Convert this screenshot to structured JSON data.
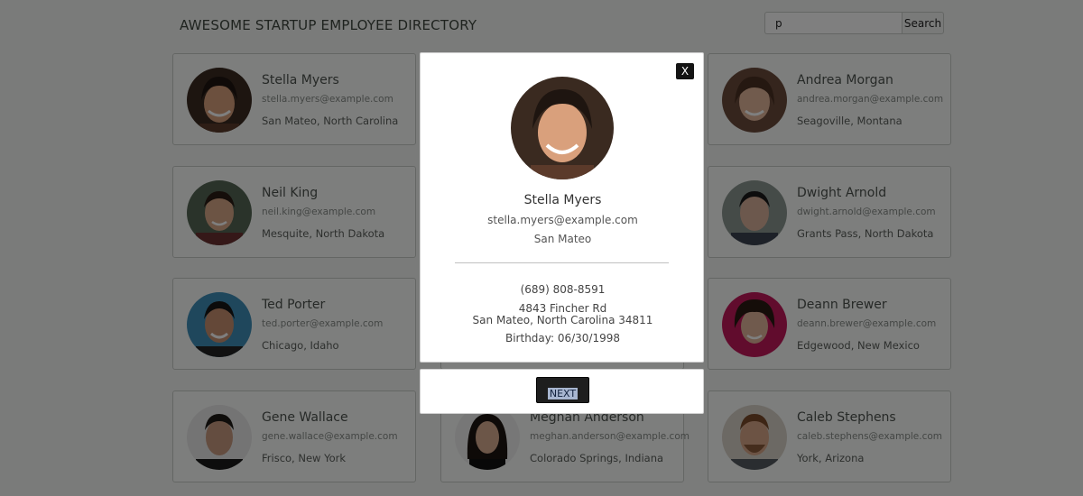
{
  "header": {
    "title": "AWESOME STARTUP EMPLOYEE DIRECTORY"
  },
  "search": {
    "value": "p",
    "button_label": "Search"
  },
  "employees": [
    {
      "name": "Stella Myers",
      "email": "stella.myers@example.com",
      "location": "San Mateo, North Carolina"
    },
    {
      "name": "",
      "email": "",
      "location": ""
    },
    {
      "name": "Andrea Morgan",
      "email": "andrea.morgan@example.com",
      "location": "Seagoville, Montana"
    },
    {
      "name": "Neil King",
      "email": "neil.king@example.com",
      "location": "Mesquite, North Dakota"
    },
    {
      "name": "",
      "email": "",
      "location": ""
    },
    {
      "name": "Dwight Arnold",
      "email": "dwight.arnold@example.com",
      "location": "Grants Pass, North Dakota"
    },
    {
      "name": "Ted Porter",
      "email": "ted.porter@example.com",
      "location": "Chicago, Idaho"
    },
    {
      "name": "",
      "email": "",
      "location": ""
    },
    {
      "name": "Deann Brewer",
      "email": "deann.brewer@example.com",
      "location": "Edgewood, New Mexico"
    },
    {
      "name": "Gene Wallace",
      "email": "gene.wallace@example.com",
      "location": "Frisco, New York"
    },
    {
      "name": "Meghan Anderson",
      "email": "meghan.anderson@example.com",
      "location": "Colorado Springs, Indiana"
    },
    {
      "name": "Caleb Stephens",
      "email": "caleb.stephens@example.com",
      "location": "York, Arizona"
    }
  ],
  "modal": {
    "close_label": "X",
    "name": "Stella Myers",
    "email": "stella.myers@example.com",
    "city": "San Mateo",
    "phone": "(689) 808-8591",
    "street": "4843 Fincher Rd",
    "city_state_zip": "San Mateo, North Carolina 34811",
    "birthday": "Birthday: 06/30/1998",
    "next_label": "NEXT"
  }
}
